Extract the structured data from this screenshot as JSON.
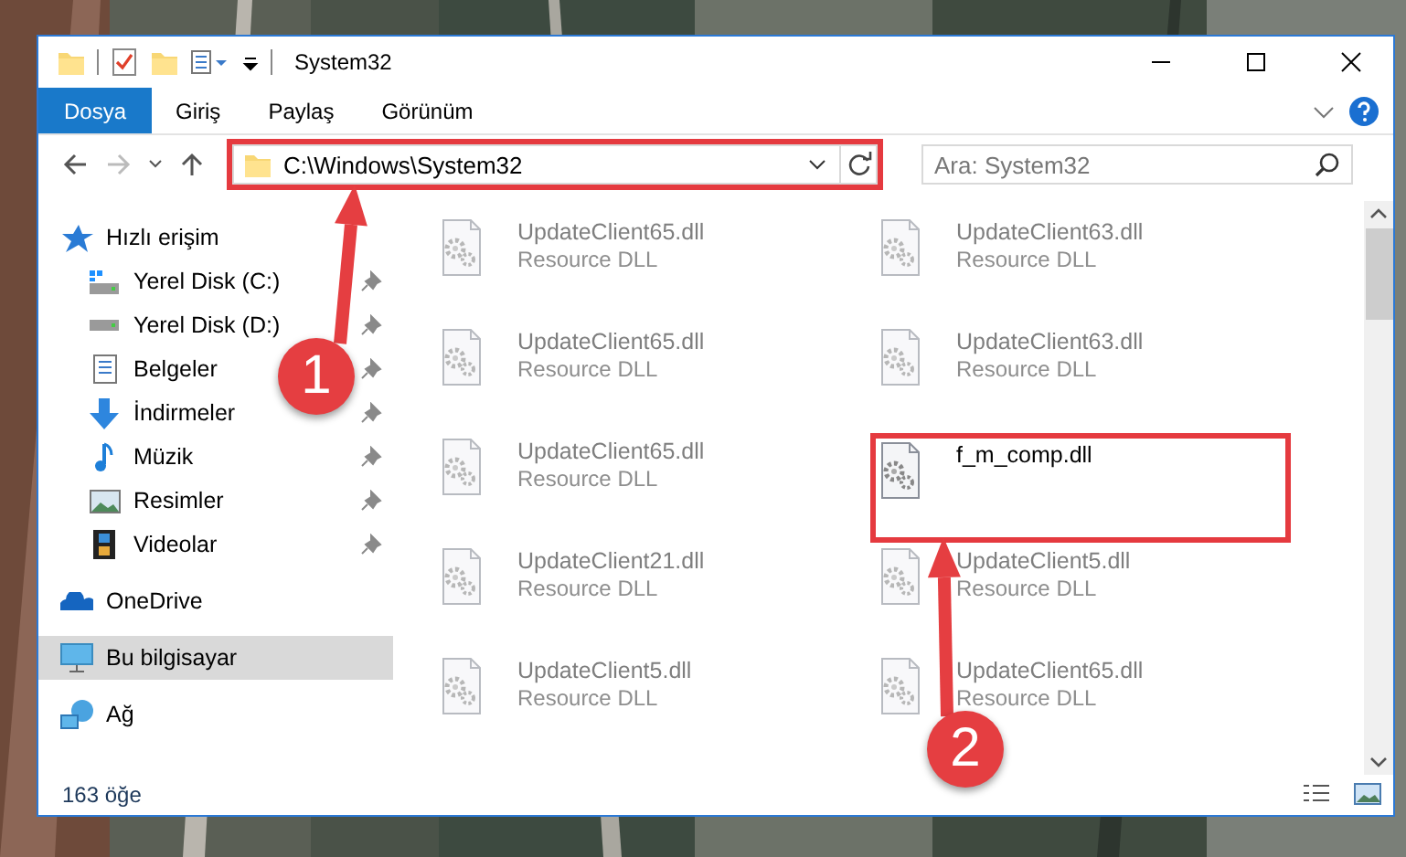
{
  "window": {
    "title": "System32"
  },
  "ribbon": {
    "tabs": [
      {
        "label": "Dosya",
        "selected": true
      },
      {
        "label": "Giriş",
        "selected": false
      },
      {
        "label": "Paylaş",
        "selected": false
      },
      {
        "label": "Görünüm",
        "selected": false
      }
    ]
  },
  "address_bar": {
    "path": "C:\\Windows\\System32",
    "highlighted": true
  },
  "search": {
    "placeholder": "Ara: System32"
  },
  "sidebar": {
    "items": [
      {
        "label": "Hızlı erişim",
        "selected": false,
        "children": [
          {
            "label": "Yerel Disk (C:)",
            "pinned": true
          },
          {
            "label": "Yerel Disk (D:)",
            "pinned": true
          },
          {
            "label": "Belgeler",
            "pinned": true
          },
          {
            "label": "İndirmeler",
            "pinned": true
          },
          {
            "label": "Müzik",
            "pinned": true
          },
          {
            "label": "Resimler",
            "pinned": true
          },
          {
            "label": "Videolar",
            "pinned": true
          }
        ]
      },
      {
        "label": "OneDrive",
        "selected": false
      },
      {
        "label": "Bu bilgisayar",
        "selected": true
      },
      {
        "label": "Ağ",
        "selected": false
      }
    ]
  },
  "files": [
    {
      "name": "UpdateClient65.dll",
      "type": "Resource DLL",
      "dimmed": true,
      "highlighted": false
    },
    {
      "name": "UpdateClient63.dll",
      "type": "Resource DLL",
      "dimmed": true,
      "highlighted": false
    },
    {
      "name": "UpdateClient65.dll",
      "type": "Resource DLL",
      "dimmed": true,
      "highlighted": false
    },
    {
      "name": "UpdateClient63.dll",
      "type": "Resource DLL",
      "dimmed": true,
      "highlighted": false
    },
    {
      "name": "UpdateClient65.dll",
      "type": "Resource DLL",
      "dimmed": true,
      "highlighted": false
    },
    {
      "name": "f_m_comp.dll",
      "dimmed": false,
      "highlighted": true
    },
    {
      "name": "UpdateClient21.dll",
      "type": "Resource DLL",
      "dimmed": true,
      "highlighted": false
    },
    {
      "name": "UpdateClient5.dll",
      "type": "Resource DLL",
      "dimmed": true,
      "highlighted": false
    },
    {
      "name": "UpdateClient5.dll",
      "type": "Resource DLL",
      "dimmed": true,
      "highlighted": false
    },
    {
      "name": "UpdateClient65.dll",
      "type": "Resource DLL",
      "dimmed": true,
      "highlighted": false
    }
  ],
  "status_bar": {
    "count": "163 öğe"
  },
  "annotations": [
    {
      "number": "1"
    },
    {
      "number": "2"
    }
  ]
}
